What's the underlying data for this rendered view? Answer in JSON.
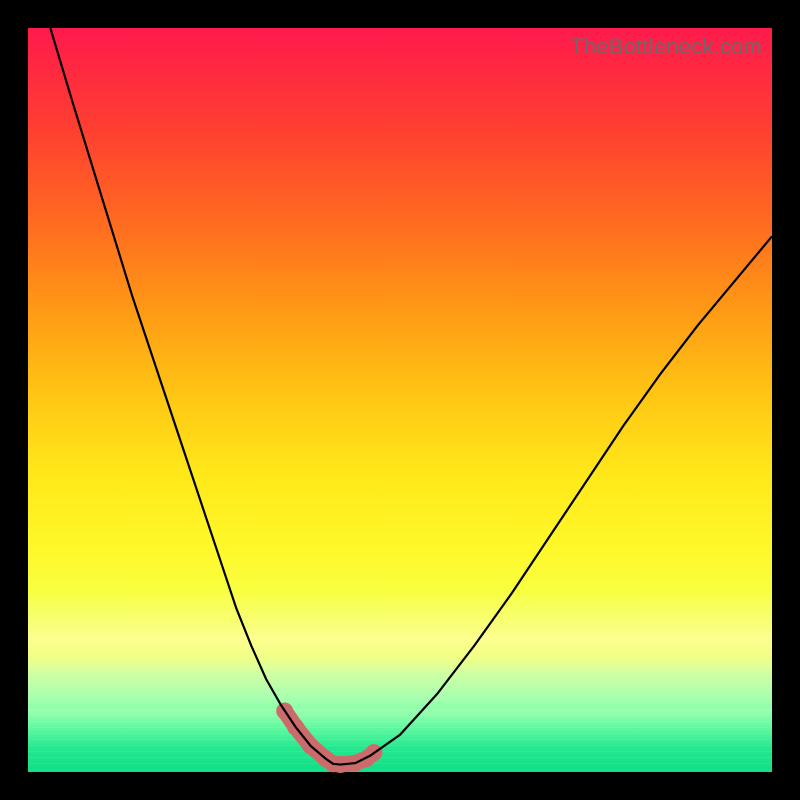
{
  "watermark": "TheBottleneck.com",
  "chart_data": {
    "type": "line",
    "title": "",
    "xlabel": "",
    "ylabel": "",
    "xlim": [
      0,
      100
    ],
    "ylim": [
      0,
      100
    ],
    "grid": false,
    "legend": false,
    "series": [
      {
        "name": "bottleneck-curve",
        "x": [
          3,
          6,
          10,
          14,
          18,
          22,
          26,
          28,
          30,
          32,
          34,
          36,
          38,
          40,
          41,
          42,
          44,
          46,
          50,
          55,
          60,
          65,
          70,
          75,
          80,
          85,
          90,
          95,
          100
        ],
        "y": [
          100,
          90,
          77,
          64,
          52,
          40,
          28,
          22,
          17,
          12.5,
          9,
          6,
          3.5,
          1.8,
          1.1,
          1,
          1.2,
          2.2,
          5,
          10.5,
          17,
          24,
          31.5,
          39,
          46.5,
          53.5,
          60,
          66,
          72
        ],
        "note": "x is a normalized parameter 0-100 across the plot width; y is percent of plot height from bottom (0=bottom, 100=top). Values were estimated from pixel positions; the chart has no axis ticks or numeric labels."
      }
    ],
    "highlight": {
      "name": "salmon-marker-segment",
      "description": "Thick rounded salmon-colored segment with dots drawn along the curve near its minimum.",
      "x_range": [
        34.5,
        46.5
      ],
      "points_x": [
        34.5,
        36,
        38,
        40,
        41,
        42,
        44,
        45.5,
        46.5
      ],
      "points_y": [
        8.2,
        6,
        3.5,
        1.8,
        1.1,
        1,
        1.2,
        1.8,
        2.6
      ],
      "color": "#cc6b6b"
    },
    "background": {
      "type": "vertical-gradient",
      "stops": [
        {
          "pos": 0,
          "color": "#ff1a4d"
        },
        {
          "pos": 50,
          "color": "#ffc814"
        },
        {
          "pos": 80,
          "color": "#f4ff60"
        },
        {
          "pos": 100,
          "color": "#10dd85"
        }
      ],
      "outer": "#000"
    }
  }
}
